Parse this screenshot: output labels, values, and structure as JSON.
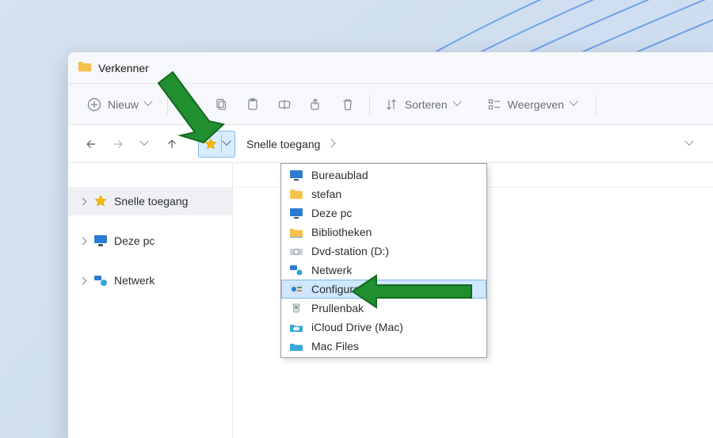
{
  "window": {
    "title": "Verkenner"
  },
  "toolbar": {
    "new_label": "Nieuw",
    "sort_label": "Sorteren",
    "view_label": "Weergeven"
  },
  "breadcrumb": {
    "root_label": "Snelle toegang"
  },
  "sidebar": {
    "items": [
      {
        "label": "Snelle toegang",
        "icon": "star"
      },
      {
        "label": "Deze pc",
        "icon": "monitor"
      },
      {
        "label": "Netwerk",
        "icon": "network"
      }
    ]
  },
  "dropdown": {
    "items": [
      {
        "label": "Bureaublad",
        "icon": "desktop"
      },
      {
        "label": "stefan",
        "icon": "folder"
      },
      {
        "label": "Deze pc",
        "icon": "monitor"
      },
      {
        "label": "Bibliotheken",
        "icon": "libraries"
      },
      {
        "label": "Dvd-station (D:)",
        "icon": "dvd"
      },
      {
        "label": "Netwerk",
        "icon": "network"
      },
      {
        "label": "Configuratiescherm",
        "icon": "control-panel",
        "highlight": true
      },
      {
        "label": "Prullenbak",
        "icon": "recycle"
      },
      {
        "label": "iCloud Drive (Mac)",
        "icon": "folder-cloud"
      },
      {
        "label": "Mac Files",
        "icon": "folder-blue"
      }
    ]
  }
}
